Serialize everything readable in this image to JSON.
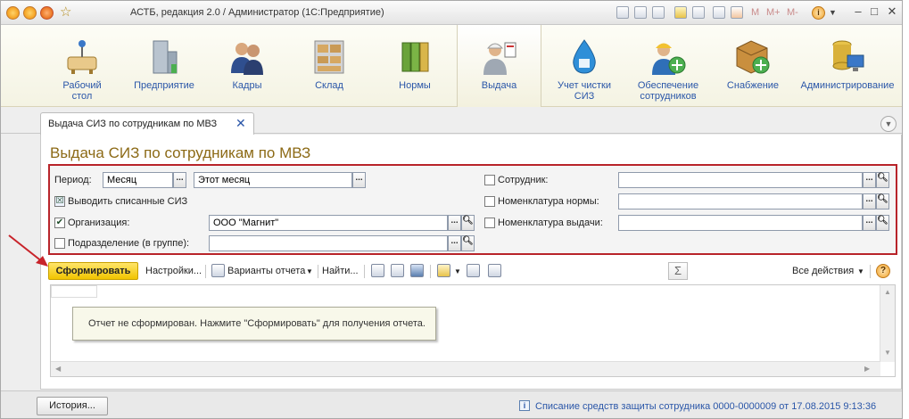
{
  "window": {
    "title": "АСТБ, редакция 2.0 / Администратор  (1С:Предприятие)",
    "tool_text": [
      "M",
      "M+",
      "M-"
    ],
    "controls": {
      "minimize": "–",
      "maximize": "□",
      "close": "✕"
    }
  },
  "sections": [
    {
      "label": "Рабочий стол",
      "icon": "desktop-icon"
    },
    {
      "label": "Предприятие",
      "icon": "building-icon"
    },
    {
      "label": "Кадры",
      "icon": "people-icon"
    },
    {
      "label": "Склад",
      "icon": "warehouse-icon"
    },
    {
      "label": "Нормы",
      "icon": "binders-icon"
    },
    {
      "label": "Выдача",
      "icon": "worker-icon",
      "active": true
    },
    {
      "label": "Учет чистки СИЗ",
      "icon": "water-drop-icon"
    },
    {
      "label": "Обеспечение сотрудников",
      "icon": "worker-add-icon"
    },
    {
      "label": "Снабжение",
      "icon": "box-add-icon"
    },
    {
      "label": "Администрирование",
      "icon": "database-computer-icon"
    }
  ],
  "tab": {
    "label": "Выдача СИЗ по сотрудникам по МВЗ",
    "close": "✕"
  },
  "form": {
    "title": "Выдача СИЗ по сотрудникам по МВЗ",
    "period_label": "Период:",
    "period_type": "Месяц",
    "period_value": "Этот месяц",
    "writeoff_label": "Выводить списанные СИЗ",
    "writeoff_checked": true,
    "org_label": "Организация:",
    "org_checked": true,
    "org_value": "ООО \"Магнит\"",
    "dept_label": "Подразделение (в группе):",
    "dept_checked": false,
    "dept_value": "",
    "employee_label": "Сотрудник:",
    "employee_value": "",
    "norm_nomen_label": "Номенклатура нормы:",
    "norm_nomen_value": "",
    "issue_nomen_label": "Номенклатура выдачи:",
    "issue_nomen_value": ""
  },
  "commands": {
    "generate": "Сформировать",
    "settings": "Настройки...",
    "variants": "Варианты отчета",
    "find": "Найти...",
    "sigma": "Σ",
    "all_actions": "Все действия",
    "help": "?"
  },
  "report": {
    "message": "Отчет не сформирован. Нажмите \"Сформировать\" для получения отчета."
  },
  "status": {
    "history": "История...",
    "link": "Списание средств защиты сотрудника 0000-0000009 от 17.08.2015 9:13:36"
  },
  "colors": {
    "accent_title": "#8c6a16",
    "link_blue": "#2a56a8",
    "generate_yellow": "#f1c400",
    "annotation_red": "#b8242a"
  }
}
